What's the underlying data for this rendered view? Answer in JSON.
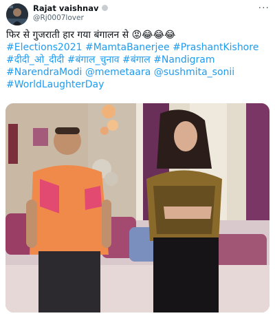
{
  "tweet": {
    "author": {
      "name": "Rajat vaishnav",
      "handle": "@Rj0007lover"
    },
    "more_label": "···",
    "text_lines": [
      [
        {
          "t": "फिर से गुजराती हार गया बंगालन से ",
          "tag": false
        },
        {
          "t": "😡😂😂😂",
          "tag": false
        }
      ],
      [
        {
          "t": "#Elections2021",
          "tag": true
        },
        {
          "t": " ",
          "tag": false
        },
        {
          "t": "#MamtaBanerjee",
          "tag": true
        },
        {
          "t": " ",
          "tag": false
        },
        {
          "t": "#PrashantKishore",
          "tag": true
        }
      ],
      [
        {
          "t": "#दीदी_ओ_दीदी",
          "tag": true
        },
        {
          "t": " ",
          "tag": false
        },
        {
          "t": "#बंगाल_चुनाव",
          "tag": true
        },
        {
          "t": " ",
          "tag": false
        },
        {
          "t": "#बंगाल",
          "tag": true
        },
        {
          "t": " ",
          "tag": false
        },
        {
          "t": "#Nandigram",
          "tag": true
        }
      ],
      [
        {
          "t": "#NarendraModi",
          "tag": true
        },
        {
          "t": " ",
          "tag": false
        },
        {
          "t": "@memetaara",
          "tag": true
        },
        {
          "t": " ",
          "tag": false
        },
        {
          "t": "@sushmita_sonii",
          "tag": true
        }
      ],
      [
        {
          "t": "#WorldLaughterDay",
          "tag": true
        }
      ]
    ],
    "colors": {
      "link": "#1d9bf0",
      "text": "#0f1419",
      "secondary": "#536471"
    }
  }
}
